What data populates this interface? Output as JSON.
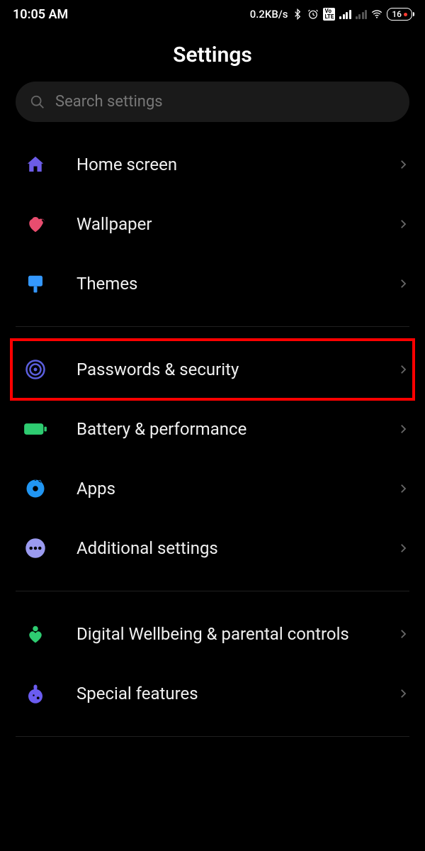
{
  "status": {
    "time": "10:05 AM",
    "data_rate": "0.2KB/s",
    "battery": "16",
    "volte": "Vo LTE"
  },
  "title": "Settings",
  "search": {
    "placeholder": "Search settings"
  },
  "groups": [
    {
      "items": [
        {
          "icon": "home-icon",
          "color": "#6c5ce7",
          "label": "Home screen"
        },
        {
          "icon": "wallpaper-icon",
          "color": "#e84d6f",
          "label": "Wallpaper"
        },
        {
          "icon": "themes-icon",
          "color": "#3498ff",
          "label": "Themes"
        }
      ]
    },
    {
      "items": [
        {
          "icon": "fingerprint-icon",
          "color": "#5b5fde",
          "label": "Passwords & security",
          "highlighted": true
        },
        {
          "icon": "battery-icon",
          "color": "#2ecc71",
          "label": "Battery & performance"
        },
        {
          "icon": "apps-icon",
          "color": "#2196f3",
          "label": "Apps"
        },
        {
          "icon": "more-icon",
          "color": "#9b9bf0",
          "label": "Additional settings"
        }
      ]
    },
    {
      "items": [
        {
          "icon": "wellbeing-icon",
          "color": "#2ecc71",
          "label": "Digital Wellbeing & parental controls"
        },
        {
          "icon": "features-icon",
          "color": "#6b5cf0",
          "label": "Special features"
        }
      ]
    }
  ]
}
